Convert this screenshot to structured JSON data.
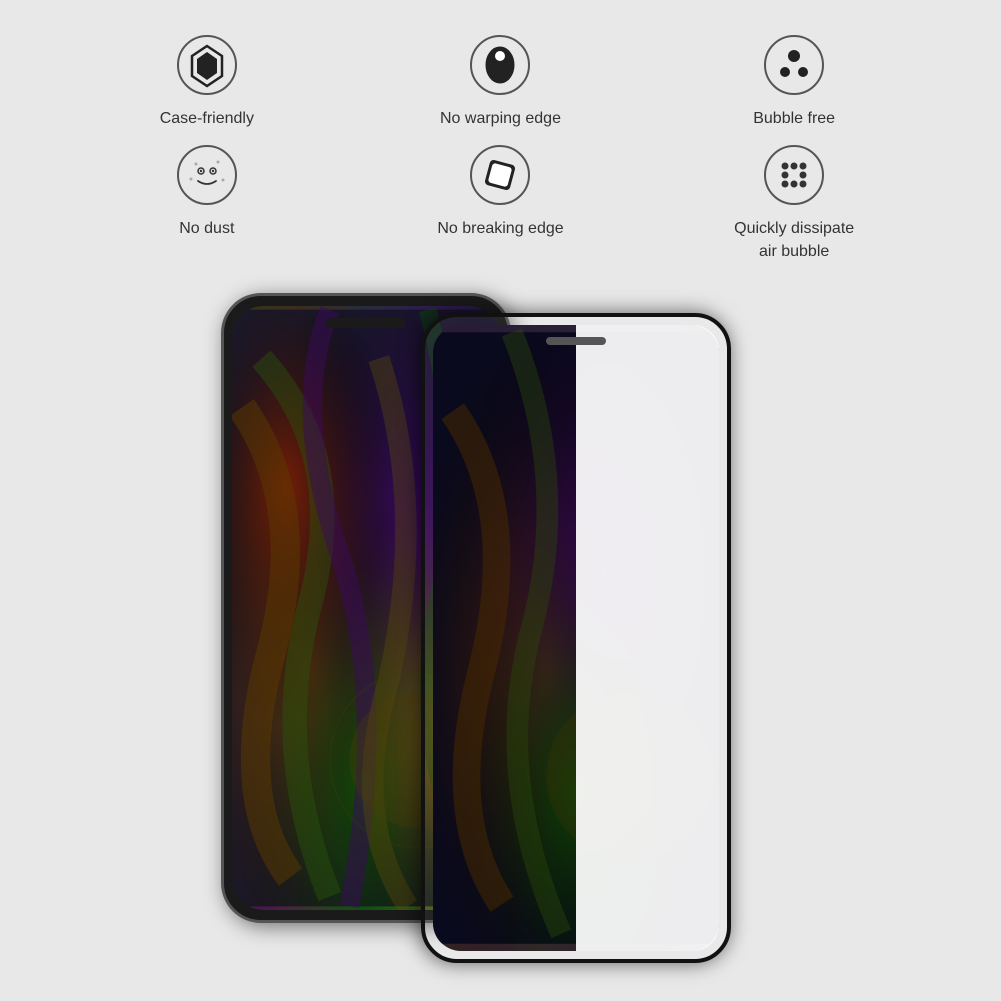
{
  "background_color": "#e0e0e0",
  "features": {
    "row1": [
      {
        "id": "case-friendly",
        "label": "Case-friendly",
        "icon_type": "diamond-shield"
      },
      {
        "id": "no-warping-edge",
        "label": "No warping edge",
        "icon_type": "oval-shape"
      },
      {
        "id": "bubble-free",
        "label": "Bubble free",
        "icon_type": "three-dots"
      }
    ],
    "row2": [
      {
        "id": "no-dust",
        "label": "No dust",
        "icon_type": "circle-dots-smile"
      },
      {
        "id": "no-breaking-edge",
        "label": "No breaking edge",
        "icon_type": "tilted-square"
      },
      {
        "id": "quickly-dissipate",
        "label": "Quickly dissipate\nair bubble",
        "icon_type": "dice-pattern"
      }
    ]
  },
  "product": {
    "name": "Screen Protector",
    "description": "iPhone tempered glass screen protector with glass overlay"
  }
}
